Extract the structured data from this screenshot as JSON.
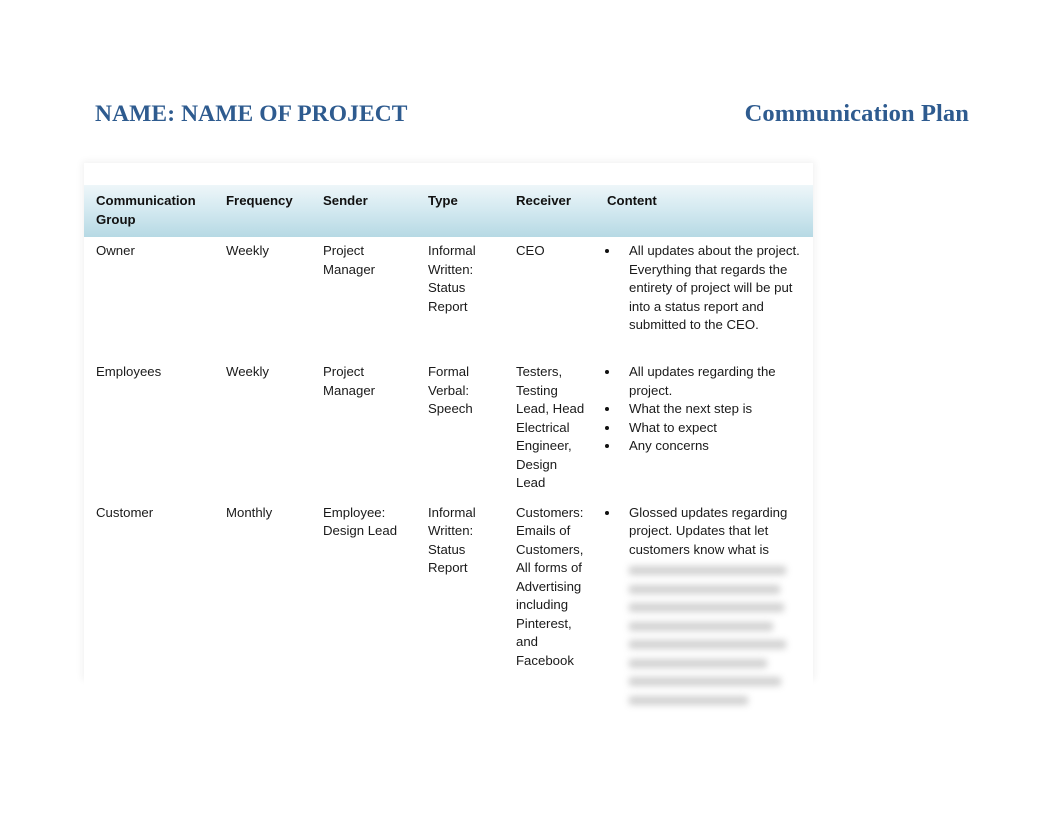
{
  "document": {
    "title_left": "NAME: NAME OF PROJECT",
    "title_right": "Communication Plan"
  },
  "table": {
    "columns": [
      "Communication Group",
      "Frequency",
      "Sender",
      "Type",
      "Receiver",
      "Content"
    ],
    "rows": [
      {
        "group": "Owner",
        "frequency": "Weekly",
        "sender": "Project Manager",
        "type": "Informal Written: Status Report",
        "receiver": "CEO",
        "content_bullets": [
          "All updates about the project. Everything that regards the entirety of project will be put into a status report and submitted to the CEO."
        ],
        "content_redacted_lines": 0
      },
      {
        "group": "Employees",
        "frequency": "Weekly",
        "sender": "Project Manager",
        "type": "Formal Verbal: Speech",
        "receiver": "Testers, Testing Lead, Head Electrical Engineer, Design Lead",
        "content_bullets": [
          "All updates regarding the project.",
          "What the next step is",
          "What to expect",
          "Any concerns"
        ],
        "content_redacted_lines": 0
      },
      {
        "group": "Customer",
        "frequency": "Monthly",
        "sender": "Employee: Design Lead",
        "type": "Informal Written: Status Report",
        "receiver": "Customers: Emails of Customers, All forms of Advertising including Pinterest, and Facebook",
        "content_bullets": [
          "Glossed updates regarding project. Updates that let customers know what is"
        ],
        "content_redacted_lines": 8
      }
    ]
  },
  "colors": {
    "title_blue": "#2e5b8f",
    "header_gradient_top": "#eef6f9",
    "header_gradient_bottom": "#b6d9e4",
    "text": "#1a1a1a",
    "page_background": "#ffffff"
  }
}
